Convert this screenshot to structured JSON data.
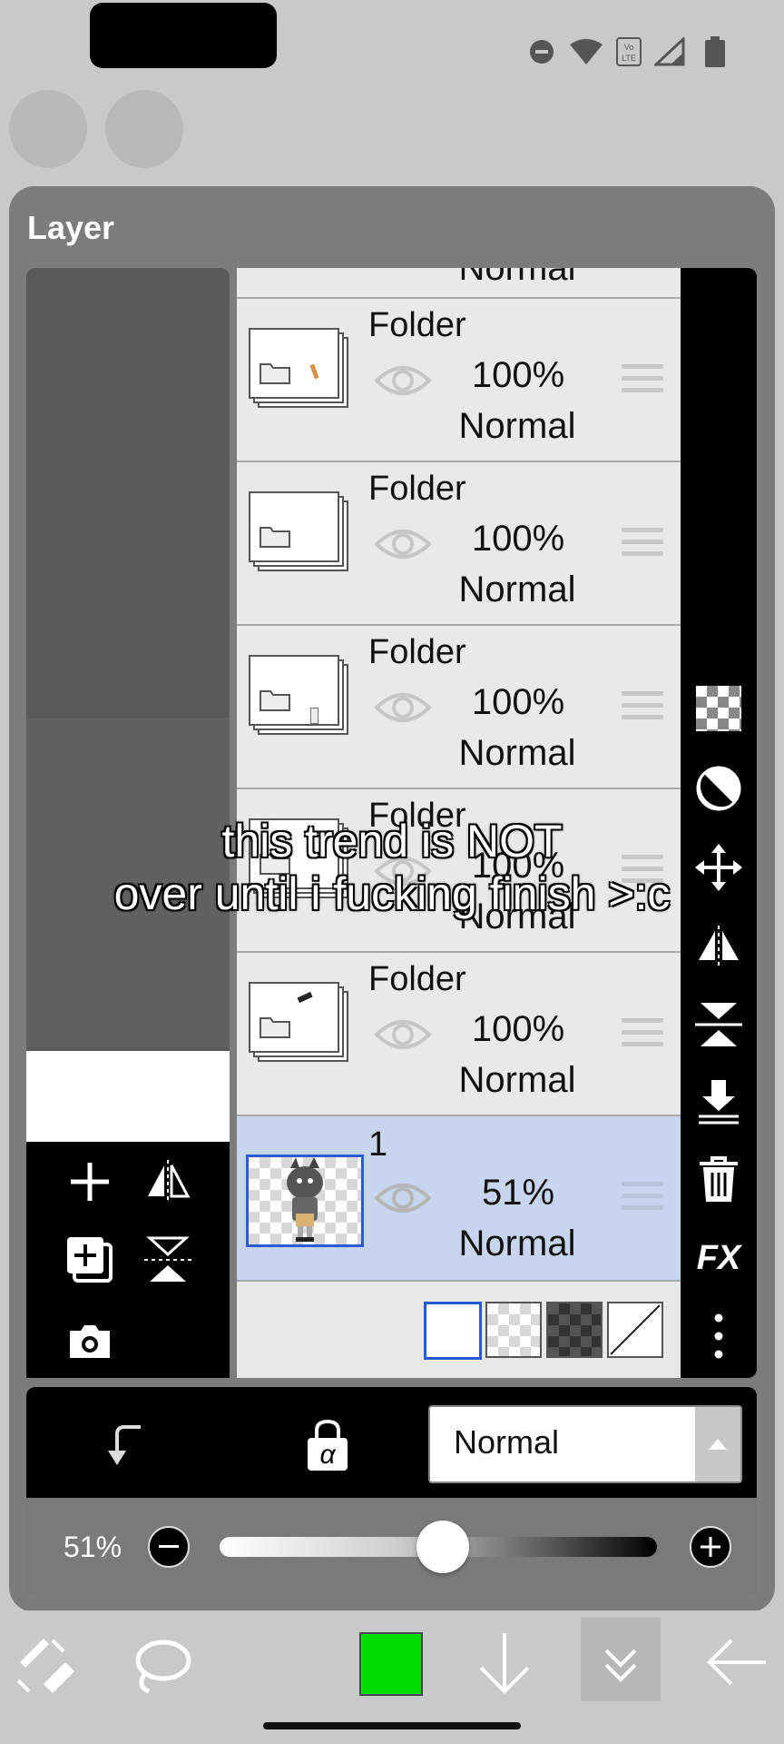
{
  "status_bar": {
    "icons": [
      "do-not-disturb-icon",
      "wifi-icon",
      "volte-icon",
      "signal-icon",
      "battery-icon"
    ],
    "volte_text": "Vo LTE"
  },
  "panel": {
    "title": "Layer",
    "top_partial_blend": "Normal",
    "layers": [
      {
        "name": "Folder",
        "opacity": "100%",
        "blend": "Normal",
        "selected": false
      },
      {
        "name": "Folder",
        "opacity": "100%",
        "blend": "Normal",
        "selected": false
      },
      {
        "name": "Folder",
        "opacity": "100%",
        "blend": "Normal",
        "selected": false
      },
      {
        "name": "Folder",
        "opacity": "100%",
        "blend": "Normal",
        "selected": false
      },
      {
        "name": "Folder",
        "opacity": "100%",
        "blend": "Normal",
        "selected": false
      },
      {
        "name": "1",
        "opacity": "51%",
        "blend": "Normal",
        "selected": true
      }
    ],
    "right_tools": [
      "checker-icon",
      "invert-icon",
      "move-icon",
      "flip-horizontal-icon",
      "flip-vertical-icon",
      "merge-down-icon",
      "trash-icon",
      "fx-button",
      "more-icon"
    ],
    "fx_label": "FX",
    "left_tools": [
      "add-layer-icon",
      "flip-horizontal-icon",
      "add-layer-copy-icon",
      "flip-vertical-icon",
      "camera-icon"
    ]
  },
  "controls": {
    "clip_icon": "clip-icon",
    "alpha_lock_icon": "alpha-lock-icon",
    "alpha_symbol": "α",
    "blend_mode": "Normal",
    "opacity_label": "51%",
    "opacity_value": 0.51
  },
  "bottom_bar": {
    "tools": [
      "brush-eraser-icon",
      "lasso-icon",
      "color-swatch",
      "down-arrow-icon",
      "collapse-icon",
      "back-arrow-icon"
    ],
    "color": "#00e000"
  },
  "caption": {
    "line1": "this trend is NOT",
    "line2": "over until i fucking finish >:c"
  }
}
